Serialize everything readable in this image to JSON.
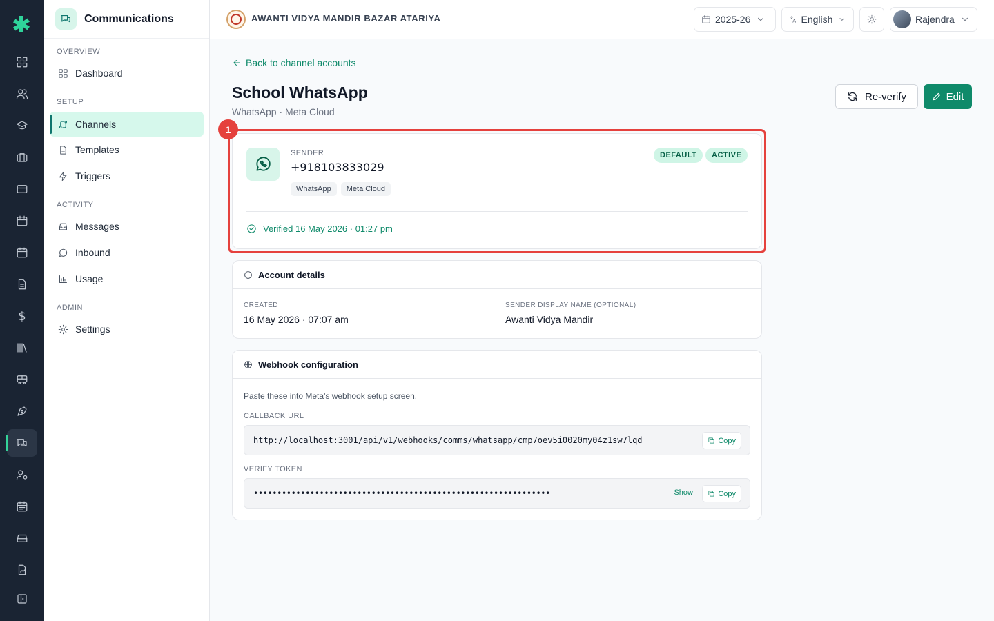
{
  "sidebar": {
    "title": "Communications",
    "sections": [
      {
        "label": "OVERVIEW",
        "items": [
          {
            "label": "Dashboard"
          }
        ]
      },
      {
        "label": "SETUP",
        "items": [
          {
            "label": "Channels"
          },
          {
            "label": "Templates"
          },
          {
            "label": "Triggers"
          }
        ]
      },
      {
        "label": "ACTIVITY",
        "items": [
          {
            "label": "Messages"
          },
          {
            "label": "Inbound"
          },
          {
            "label": "Usage"
          }
        ]
      },
      {
        "label": "ADMIN",
        "items": [
          {
            "label": "Settings"
          }
        ]
      }
    ]
  },
  "rail": {
    "icons": [
      "grid-icon",
      "users-icon",
      "graduation-cap-icon",
      "briefcase-icon",
      "card-icon",
      "calendar-icon",
      "calendar-alt-icon",
      "document-icon",
      "dollar-icon",
      "library-icon",
      "bus-icon",
      "pen-tool-icon",
      "chat-icon",
      "user-cog-icon",
      "calendar-grid-icon",
      "drive-icon",
      "file-signature-icon",
      "collapse-icon"
    ],
    "dollar_glyph": "$",
    "active": "chat-icon"
  },
  "topbar": {
    "school_name": "AWANTI VIDYA MANDIR BAZAR ATARIYA",
    "year": "2025-26",
    "language": "English",
    "user": "Rajendra"
  },
  "page": {
    "back_label": "Back to channel accounts",
    "title": "School WhatsApp",
    "subtitle": "WhatsApp · Meta Cloud",
    "reverify_label": "Re-verify",
    "edit_label": "Edit"
  },
  "highlight": {
    "number": "1",
    "color": "#e5413d"
  },
  "sender": {
    "label": "SENDER",
    "number": "+918103833029",
    "chips": [
      "WhatsApp",
      "Meta Cloud"
    ],
    "badges": [
      "DEFAULT",
      "ACTIVE"
    ],
    "verified": "Verified 16 May 2026 · 01:27 pm"
  },
  "account": {
    "title": "Account details",
    "created_label": "CREATED",
    "created_value": "16 May 2026 · 07:07 am",
    "display_label": "SENDER DISPLAY NAME (OPTIONAL)",
    "display_value": "Awanti Vidya Mandir"
  },
  "webhook": {
    "title": "Webhook configuration",
    "description": "Paste these into Meta's webhook setup screen.",
    "callback_label": "CALLBACK URL",
    "callback_value": "http://localhost:3001/api/v1/webhooks/comms/whatsapp/cmp7oev5i0020my04z1sw7lqd",
    "token_label": "VERIFY TOKEN",
    "token_value": "•••••••••••••••••••••••••••••••••••••••••••••••••••••••••••••••",
    "show_label": "Show",
    "copy_label": "Copy"
  },
  "colors": {
    "accent": "#0f8a6a",
    "rail_bg": "#1a2433",
    "active_bg": "#d6f8ec"
  }
}
